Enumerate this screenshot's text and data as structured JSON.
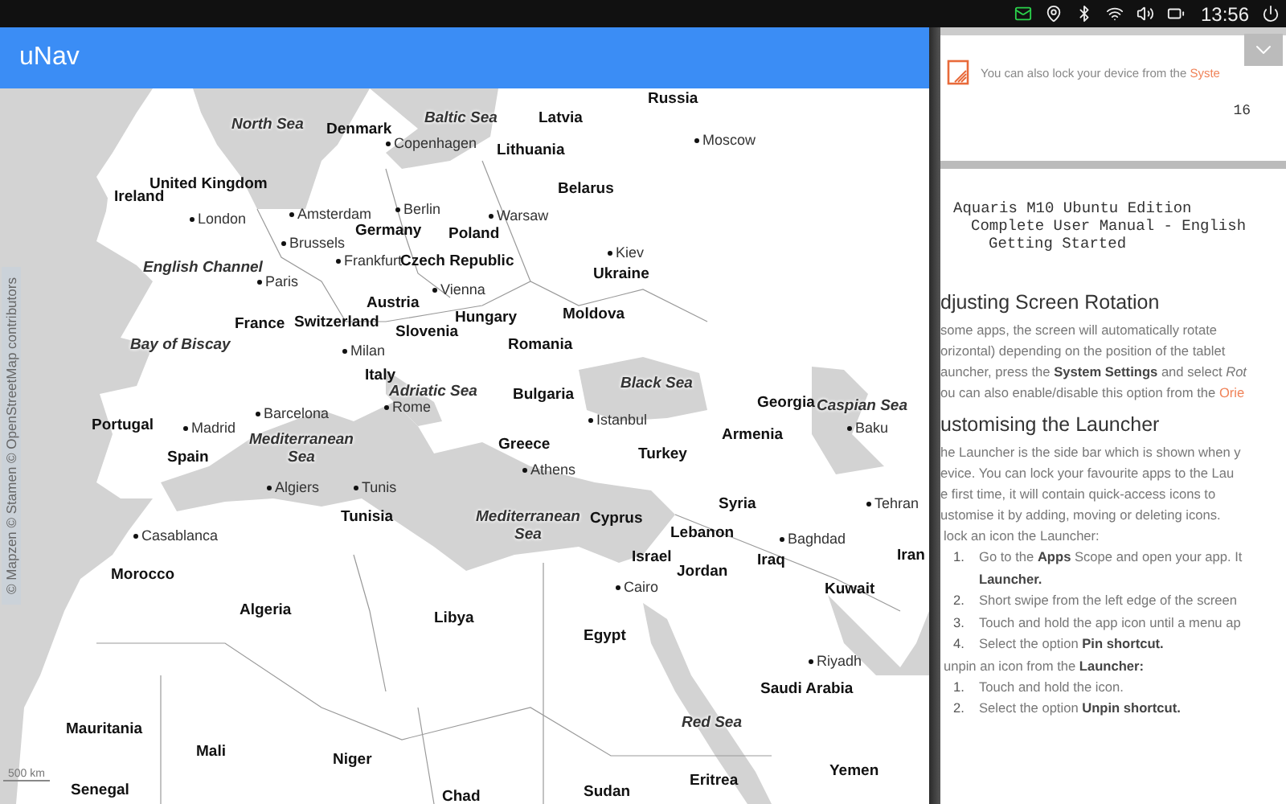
{
  "status_bar": {
    "time": "13:56"
  },
  "app": {
    "title": "uNav"
  },
  "map": {
    "attribution": "© Mapzen © Stamen © OpenStreetMap contributors",
    "scale": "500 km",
    "labels": [
      {
        "kind": "country",
        "text": "Russia"
      },
      {
        "kind": "country",
        "text": "Latvia"
      },
      {
        "kind": "country",
        "text": "Denmark"
      },
      {
        "kind": "sea",
        "text": "North Sea"
      },
      {
        "kind": "sea",
        "text": "Baltic Sea"
      },
      {
        "kind": "city",
        "text": "Copenhagen"
      },
      {
        "kind": "city",
        "text": "Moscow"
      },
      {
        "kind": "country",
        "text": "Lithuania"
      },
      {
        "kind": "country",
        "text": "Belarus"
      },
      {
        "kind": "country",
        "text": "United Kingdom"
      },
      {
        "kind": "country",
        "text": "Ireland"
      },
      {
        "kind": "city",
        "text": "London"
      },
      {
        "kind": "city",
        "text": "Amsterdam"
      },
      {
        "kind": "city",
        "text": "Berlin"
      },
      {
        "kind": "city",
        "text": "Warsaw"
      },
      {
        "kind": "country",
        "text": "Germany"
      },
      {
        "kind": "country",
        "text": "Poland"
      },
      {
        "kind": "city",
        "text": "Brussels"
      },
      {
        "kind": "city",
        "text": "Kiev"
      },
      {
        "kind": "city",
        "text": "Frankfurt"
      },
      {
        "kind": "country",
        "text": "Czech Republic"
      },
      {
        "kind": "sea",
        "text": "English Channel"
      },
      {
        "kind": "city",
        "text": "Paris"
      },
      {
        "kind": "country",
        "text": "Ukraine"
      },
      {
        "kind": "city",
        "text": "Vienna"
      },
      {
        "kind": "country",
        "text": "Austria"
      },
      {
        "kind": "country",
        "text": "France"
      },
      {
        "kind": "country",
        "text": "Switzerland"
      },
      {
        "kind": "country",
        "text": "Hungary"
      },
      {
        "kind": "country",
        "text": "Moldova"
      },
      {
        "kind": "country",
        "text": "Slovenia"
      },
      {
        "kind": "sea",
        "text": "Bay of Biscay"
      },
      {
        "kind": "city",
        "text": "Milan"
      },
      {
        "kind": "country",
        "text": "Romania"
      },
      {
        "kind": "country",
        "text": "Italy"
      },
      {
        "kind": "sea",
        "text": "Adriatic Sea"
      },
      {
        "kind": "country",
        "text": "Bulgaria"
      },
      {
        "kind": "sea",
        "text": "Black Sea"
      },
      {
        "kind": "city",
        "text": "Barcelona"
      },
      {
        "kind": "city",
        "text": "Rome"
      },
      {
        "kind": "country",
        "text": "Georgia"
      },
      {
        "kind": "sea",
        "text": "Caspian Sea"
      },
      {
        "kind": "country",
        "text": "Portugal"
      },
      {
        "kind": "city",
        "text": "Madrid"
      },
      {
        "kind": "city",
        "text": "Istanbul"
      },
      {
        "kind": "country",
        "text": "Armenia"
      },
      {
        "kind": "city",
        "text": "Baku"
      },
      {
        "kind": "country",
        "text": "Spain"
      },
      {
        "kind": "sea",
        "text": "Mediterranean Sea"
      },
      {
        "kind": "country",
        "text": "Greece"
      },
      {
        "kind": "country",
        "text": "Turkey"
      },
      {
        "kind": "city",
        "text": "Athens"
      },
      {
        "kind": "city",
        "text": "Algiers"
      },
      {
        "kind": "city",
        "text": "Tunis"
      },
      {
        "kind": "country",
        "text": "Tunisia"
      },
      {
        "kind": "sea",
        "text": "Mediterranean Sea"
      },
      {
        "kind": "country",
        "text": "Cyprus"
      },
      {
        "kind": "country",
        "text": "Syria"
      },
      {
        "kind": "city",
        "text": "Tehran"
      },
      {
        "kind": "city",
        "text": "Casablanca"
      },
      {
        "kind": "country",
        "text": "Lebanon"
      },
      {
        "kind": "city",
        "text": "Baghdad"
      },
      {
        "kind": "country",
        "text": "Morocco"
      },
      {
        "kind": "country",
        "text": "Israel"
      },
      {
        "kind": "country",
        "text": "Jordan"
      },
      {
        "kind": "country",
        "text": "Iraq"
      },
      {
        "kind": "country",
        "text": "Iran"
      },
      {
        "kind": "city",
        "text": "Cairo"
      },
      {
        "kind": "country",
        "text": "Kuwait"
      },
      {
        "kind": "country",
        "text": "Algeria"
      },
      {
        "kind": "country",
        "text": "Libya"
      },
      {
        "kind": "country",
        "text": "Egypt"
      },
      {
        "kind": "city",
        "text": "Riyadh"
      },
      {
        "kind": "country",
        "text": "Saudi Arabia"
      },
      {
        "kind": "sea",
        "text": "Red Sea"
      },
      {
        "kind": "country",
        "text": "Mauritania"
      },
      {
        "kind": "country",
        "text": "Mali"
      },
      {
        "kind": "country",
        "text": "Niger"
      },
      {
        "kind": "country",
        "text": "Eritrea"
      },
      {
        "kind": "country",
        "text": "Yemen"
      },
      {
        "kind": "country",
        "text": "Senegal"
      },
      {
        "kind": "country",
        "text": "Chad"
      },
      {
        "kind": "country",
        "text": "Sudan"
      }
    ]
  },
  "manual_panel": {
    "notice": {
      "text": "You can also lock your device from the ",
      "link": "Syste"
    },
    "page_number": "16",
    "header_lines": [
      "Aquaris M10 Ubuntu Edition",
      "Complete User Manual - English",
      "Getting Started"
    ],
    "content": [
      {
        "kind": "heading",
        "text": "djusting Screen Rotation"
      },
      {
        "kind": "line",
        "text": "some apps, the screen will automatically rotate"
      },
      {
        "kind": "line",
        "text": "orizontal) depending on the position of the tablet"
      },
      {
        "kind": "line",
        "text": "auncher, press the **System Settings** and select *Rot*"
      },
      {
        "kind": "line",
        "text": "ou can also enable/disable this option from the ",
        "link": "Orie"
      },
      {
        "kind": "heading",
        "text": "ustomising the Launcher"
      },
      {
        "kind": "line",
        "text": "he Launcher is the side bar which is shown when y"
      },
      {
        "kind": "line",
        "text": "evice. You can lock your favourite apps to the Lau"
      },
      {
        "kind": "line",
        "text": "e first time, it will contain quick-access icons to"
      },
      {
        "kind": "line",
        "text": "ustomise it by adding, moving or deleting icons."
      },
      {
        "kind": "lead",
        "text": "lock an icon the Launcher:"
      },
      {
        "kind": "item",
        "number": "1.",
        "text": "Go to the **Apps** Scope and open your app. It"
      },
      {
        "kind": "item",
        "text": "**Launcher.**"
      },
      {
        "kind": "item",
        "number": "2.",
        "text": "Short swipe from the left edge of the screen"
      },
      {
        "kind": "item",
        "number": "3.",
        "text": "Touch and hold the app icon until a menu ap"
      },
      {
        "kind": "item",
        "number": "4.",
        "text": "Select the option **Pin shortcut.**"
      },
      {
        "kind": "lead",
        "text": "unpin an icon from the **Launcher:**"
      },
      {
        "kind": "item",
        "number": "1.",
        "text": "Touch and hold the icon."
      },
      {
        "kind": "item",
        "number": "2.",
        "text": "Select the option **Unpin shortcut.**"
      }
    ]
  }
}
